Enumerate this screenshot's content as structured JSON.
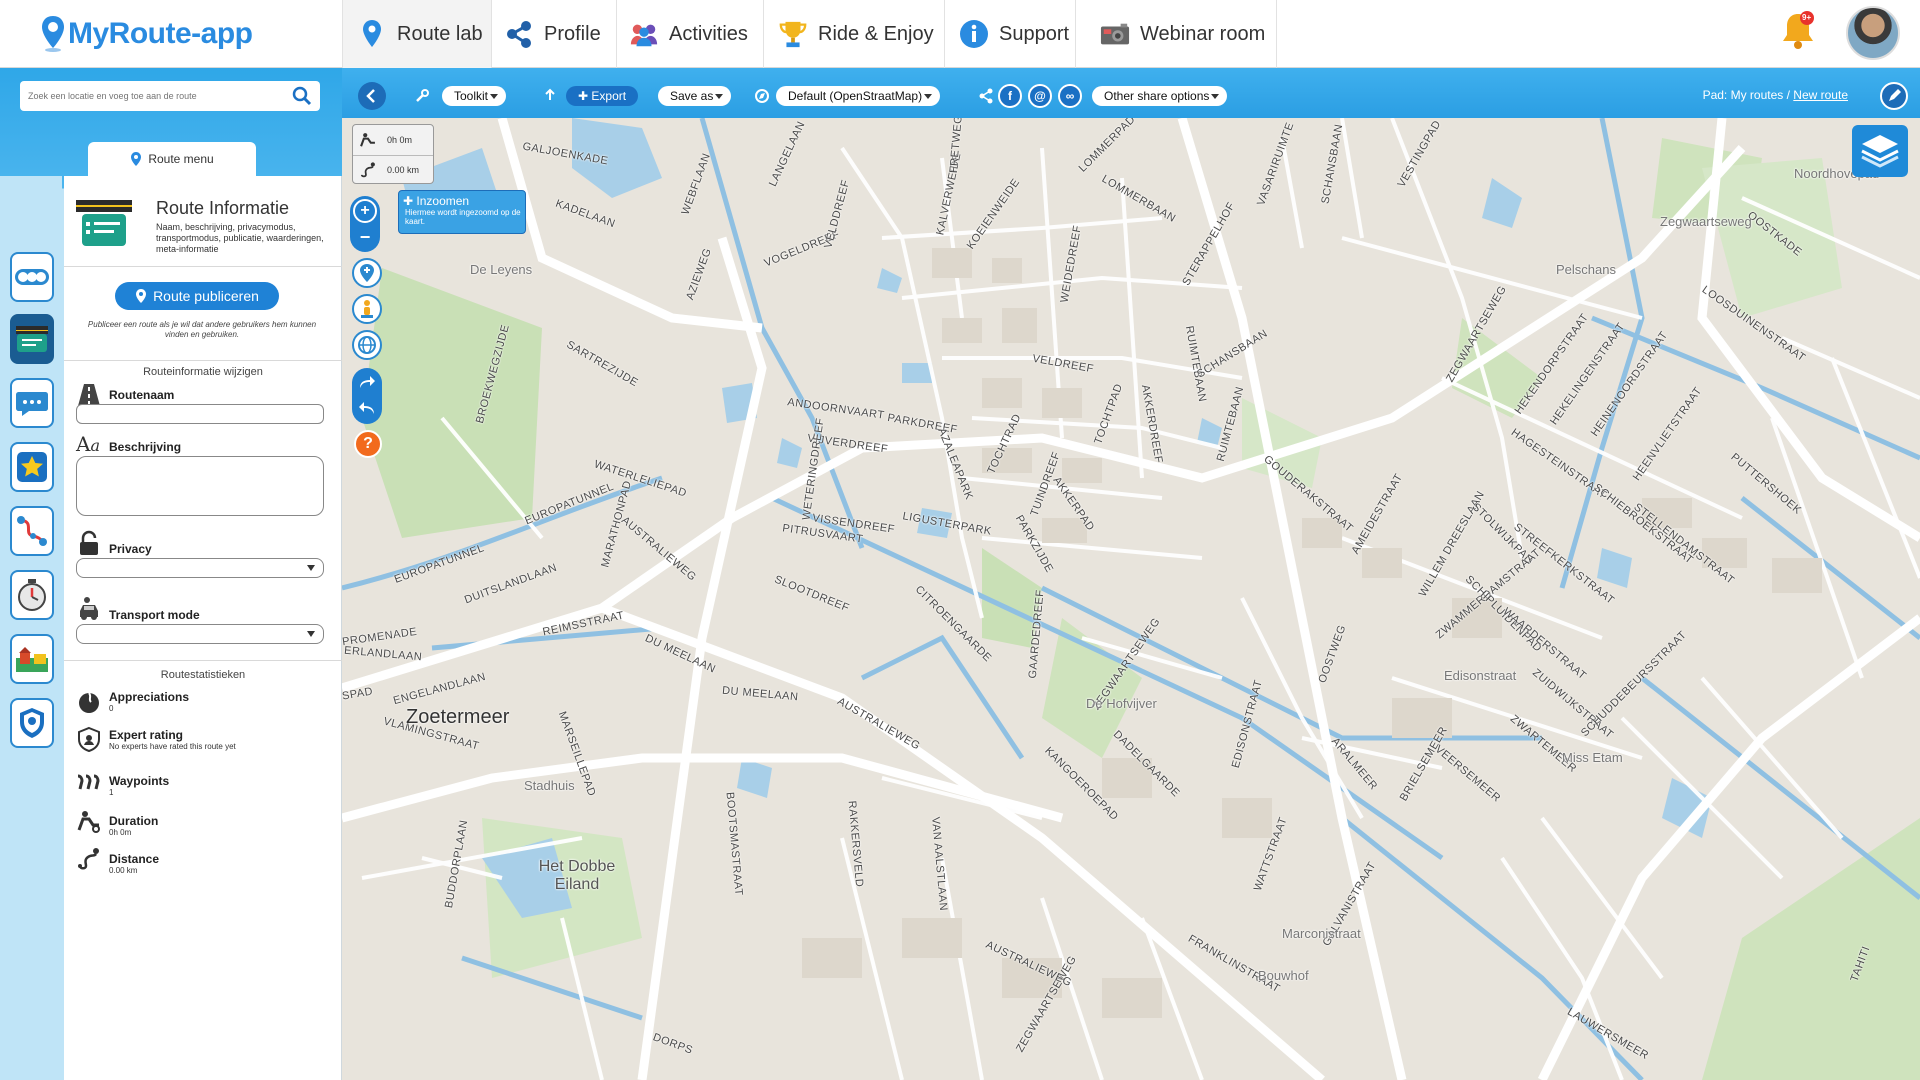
{
  "app": {
    "logo_text": "MyRoute-app"
  },
  "nav": {
    "items": [
      {
        "label": "Route lab",
        "icon": "map-pin-icon"
      },
      {
        "label": "Profile",
        "icon": "share-icon"
      },
      {
        "label": "Activities",
        "icon": "people-icon"
      },
      {
        "label": "Ride & Enjoy",
        "icon": "trophy-icon"
      },
      {
        "label": "Support",
        "icon": "info-icon"
      },
      {
        "label": "Webinar room",
        "icon": "camera-icon"
      }
    ],
    "notifications_badge": "9+"
  },
  "search": {
    "placeholder": "Zoek een locatie en voeg toe aan de route"
  },
  "route_menu_tab": "Route menu",
  "route_info": {
    "title": "Route Informatie",
    "description": "Naam, beschrijving, privacymodus, transportmodus, publicatie, waarderingen, meta-informatie",
    "publish_label": "Route publiceren",
    "publish_note": "Publiceer een route als je wil dat andere gebruikers hem kunnen vinden en gebruiken.",
    "edit_section": "Routeinformatie wijzigen",
    "fields": {
      "name_label": "Routenaam",
      "description_label": "Beschrijving",
      "privacy_label": "Privacy",
      "transport_label": "Transport mode"
    },
    "stats_section": "Routestatistieken",
    "stats": [
      {
        "label": "Appreciations",
        "value": "0"
      },
      {
        "label": "Expert rating",
        "value": "No experts have rated this route yet"
      },
      {
        "label": "Waypoints",
        "value": "1"
      },
      {
        "label": "Duration",
        "value": "0h 0m"
      },
      {
        "label": "Distance",
        "value": "0.00 km"
      }
    ]
  },
  "toolbar": {
    "toolkit": "Toolkit",
    "export": "Export",
    "save_as": "Save as",
    "map_style": "Default (OpenStraatMap)",
    "share_options": "Other share options",
    "path_prefix": "Pad: My routes /",
    "path_current": "New route"
  },
  "map": {
    "stats_time": "0h 0m",
    "stats_distance": "0.00 km",
    "zoom_tip_title": "Inzoomen",
    "zoom_tip_text": "Hiermee wordt ingezoomd op de kaart.",
    "streets": [
      "GALJOENKADE",
      "KADELAAN",
      "WEBFLAAN",
      "AZIEWEG",
      "VOGELDREEF",
      "VELDDREEF",
      "KALVERWEIDE",
      "KOEIENWEIDE",
      "WEIDEDREEF",
      "LANGELAAN",
      "FRETWEG",
      "LOMMERPAD",
      "LOMMERBAAN",
      "VASARIRUIMTE",
      "STERAPPELHOF",
      "SCHANSBAAN",
      "VESTINGPAD",
      "SARTREZIJDE",
      "BROEKWEGZIJDE",
      "ANDOORNVAART",
      "PARKDREEF",
      "VIJVERDREEF",
      "AZALEAPARK",
      "LIGUSTERPARK",
      "PITRUSVAART",
      "VELDREEF",
      "TOCHTPAD",
      "AKKERDREEF",
      "RUIMTEBAAN",
      "SCHANSBAAN",
      "ZEGWAARTSEWEG",
      "HEKENDORPSTRAAT",
      "HEKELINGENSTRAAT",
      "HEINENOORDSTRAAT",
      "HAGESTEINSTRAAT",
      "HEENVLIETSTRAAT",
      "LOOSDUINENSTRAAT",
      "OOSTKADE",
      "WATERLELIEPAD",
      "EUROPATUNNEL",
      "MARATHONPAD",
      "AUSTRALIEWEG",
      "WETERINGDREEF",
      "VISSENDREEF",
      "TUINDREEF",
      "AKKERPAD",
      "TOCHTRAD",
      "PARKZIJDE",
      "EUROPATUNNEL",
      "DUITSLANDLAAN",
      "SLOOTDREEF",
      "CITROENGAARDE",
      "GAARDEDREEF",
      "ZEGWAARTSEWEG",
      "GOUDERAKSTRAAT",
      "AMEIDESTRAAT",
      "WILLEM DREESLAAN",
      "STOLWIJKPAD",
      "STREEFKERKSTRAAT",
      "SCHIEBROEKSTRAAT",
      "STELLENDAMSTRAAT",
      "PUTTERSHOEK",
      "ZWAMMERDAMSTRAAT",
      "SCHIPLUIDENPAD",
      "WAARDERSTRAAT",
      "ZUIDWIJKSTRAAT",
      "SCHUDDEBEURSSTRAAT",
      "ZWARTEMEER",
      "BRIELSEMEER",
      "VEERSEMEER",
      "ARALMEER",
      "OOSTWEG",
      "RUIMTEBAAN",
      "PROMENADE",
      "REIMSSTRAAT",
      "DU MEELAAN",
      "ERLANDLAAN",
      "ENGELANDLAAN",
      "VLAMINGSTRAAT",
      "MARSEILLEPAD",
      "DU MEELAAN",
      "AUSTRALIEWEG",
      "DADELGAARDE",
      "EDISONSTRAAT",
      "WATTSTRAAT",
      "GALVANISTRAAT",
      "FRANKLINSTRAAT",
      "KANGOEROEPAD",
      "BUDDORPLAAN",
      "BOOTSMASTRAAT",
      "RAKKERSVELD",
      "VAN AALSTLAAN",
      "DORPS",
      "TAHITI",
      "LAUWERSMEER",
      "ZEGWAARTSEWEG",
      "AUSTRALIEWEG",
      "SPAD"
    ],
    "places": [
      "De Leyens",
      "Pelschans",
      "Zegwaartseweg",
      "Noordhovepad",
      "De Hofvijver",
      "Edisonstraat",
      "Miss Etam",
      "Stadhuis",
      "Marconistraat",
      "Bouwhof"
    ],
    "city": "Zoetermeer",
    "district": "Het Dobbe Eiland"
  },
  "colors": {
    "primary": "#2a8be0",
    "toolbar": "#2b9ee3",
    "map_bg": "#e8e4dc",
    "water": "#a8cfe8"
  }
}
